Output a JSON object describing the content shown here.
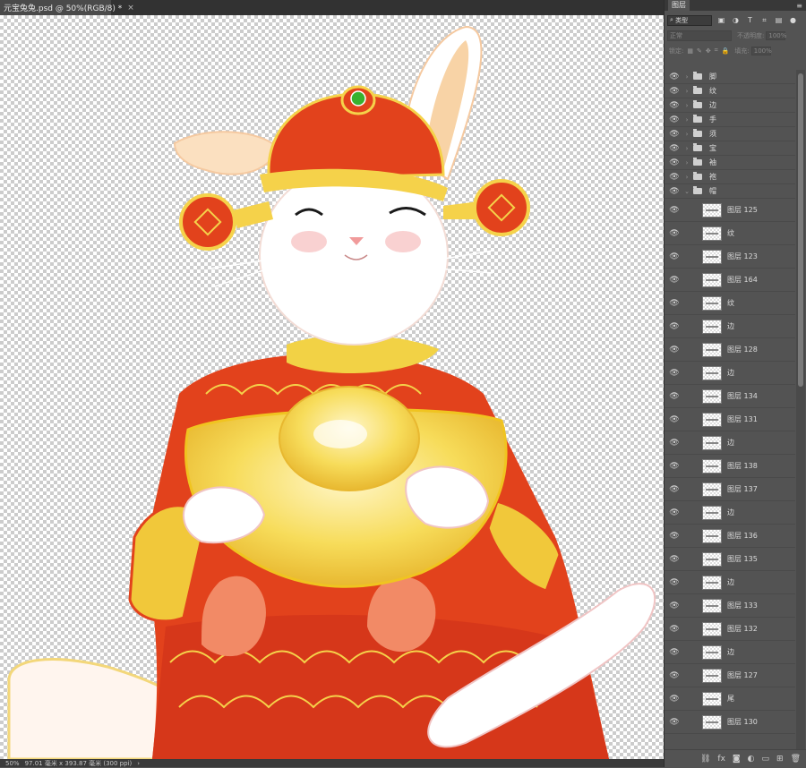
{
  "document": {
    "tab_title": "元宝兔兔.psd @ 50%(RGB/8) *",
    "close_glyph": "×"
  },
  "status": {
    "zoom": "50%",
    "doc_size": "97.01 毫米 x 393.87 毫米 (300 ppi)",
    "arrow": "›"
  },
  "panel": {
    "tab": "图层",
    "menu_glyph": "≡",
    "filter_label": "类型",
    "blend_mode": "正常",
    "opacity_label": "不透明度:",
    "opacity_value": "100%",
    "lock_label": "锁定:",
    "fill_label": "填充:",
    "fill_value": "100%",
    "groups": [
      {
        "name": "脚",
        "expanded": false
      },
      {
        "name": "纹",
        "expanded": false
      },
      {
        "name": "边",
        "expanded": false
      },
      {
        "name": "手",
        "expanded": false
      },
      {
        "name": "须",
        "expanded": false
      },
      {
        "name": "宝",
        "expanded": false
      },
      {
        "name": "袖",
        "expanded": false
      },
      {
        "name": "袍",
        "expanded": false
      },
      {
        "name": "帽",
        "expanded": true
      }
    ],
    "layers": [
      {
        "name": "图层 125"
      },
      {
        "name": "纹"
      },
      {
        "name": "图层 123"
      },
      {
        "name": "图层 164"
      },
      {
        "name": "纹"
      },
      {
        "name": "边"
      },
      {
        "name": "图层 128"
      },
      {
        "name": "边"
      },
      {
        "name": "图层 134"
      },
      {
        "name": "图层 131"
      },
      {
        "name": "边"
      },
      {
        "name": "图层 138"
      },
      {
        "name": "图层 137"
      },
      {
        "name": "边"
      },
      {
        "name": "图层 136"
      },
      {
        "name": "图层 135"
      },
      {
        "name": "边"
      },
      {
        "name": "图层 133"
      },
      {
        "name": "图层 132"
      },
      {
        "name": "边"
      },
      {
        "name": "图层 127"
      },
      {
        "name": "尾"
      },
      {
        "name": "图层 130"
      }
    ],
    "footer_icons": [
      "link-icon",
      "fx-icon",
      "mask-icon",
      "adjustment-icon",
      "new-group-icon",
      "new-layer-icon",
      "trash-icon"
    ]
  },
  "colors": {
    "accent_red": "#d93a1c",
    "gold": "#f5d24a",
    "panel_bg": "#535353"
  }
}
